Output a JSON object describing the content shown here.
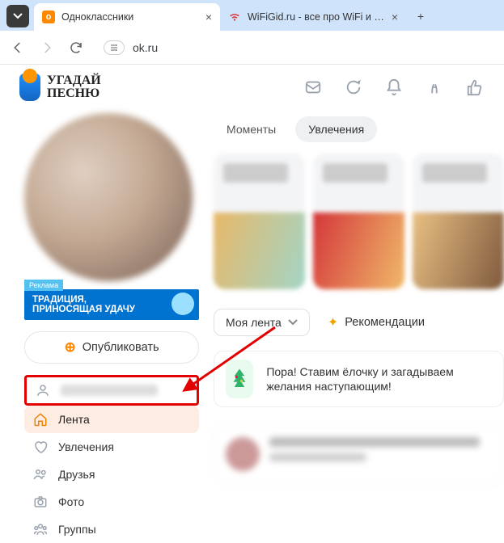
{
  "browser": {
    "tabs": [
      {
        "title": "Одноклассники",
        "favicon": "ok"
      },
      {
        "title": "WiFiGid.ru - все про WiFi и без…",
        "favicon": "wifi"
      }
    ],
    "url": "ok.ru"
  },
  "logo": {
    "line1": "УГАДАЙ",
    "line2": "ПЕСНЮ"
  },
  "sidebar": {
    "promo_ad_label": "Реклама",
    "promo_line1": "ТРАДИЦИЯ,",
    "promo_line2": "ПРИНОСЯЩАЯ УДАЧУ",
    "publish_label": "Опубликовать",
    "items": {
      "feed": "Лента",
      "hobbies": "Увлечения",
      "friends": "Друзья",
      "photo": "Фото",
      "groups": "Группы"
    }
  },
  "main": {
    "tabs": {
      "moments": "Моменты",
      "hobbies": "Увлечения"
    },
    "feed_selector": "Моя лента",
    "recommendations": "Рекомендации",
    "banner_text": "Пора! Ставим ёлочку и загадываем желания наступающим!"
  }
}
